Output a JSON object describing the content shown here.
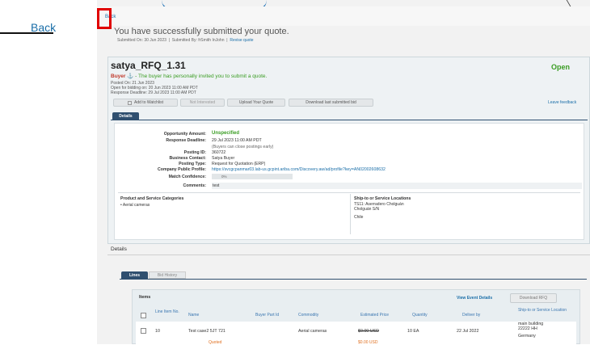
{
  "sidebar": {
    "back_label": "Back"
  },
  "header": {
    "back_link": "Back",
    "submitted_title": "You have successfully submitted your quote.",
    "submitted_on": "Submitted On: 30 Jun 2023",
    "submitted_by": "Submitted By: frSmith InJohn",
    "revise_quote": "Revise quote"
  },
  "rfq": {
    "title": "satya_RFQ_1.31",
    "status": "Open",
    "buyer_word": "Buyer",
    "buyer_message": " - The buyer has personally invited you to submit a quote.",
    "posted_on": "Posted On:  21 Jun 2023",
    "open_for_bidding": "Open for bidding on:  20 Jun 2023 11:00 AM PDT",
    "response_deadline": "Response Deadline:  29 Jul 2023 11:00 AM PDT"
  },
  "toolbar": {
    "add_watchlist": "Add to Watchlist",
    "not_interested": "Not Interested",
    "upload_quote": "Upload Your Quote",
    "download_bid": "Download last submitted bid",
    "leave_feedback": "Leave feedback"
  },
  "tabs": {
    "details": "Details"
  },
  "details": {
    "opportunity_amount_label": "Opportunity Amount:",
    "opportunity_amount": "Unspecified",
    "response_deadline_label": "Response Deadline:",
    "response_deadline": "29 Jul 2023 11:00 AM PDT",
    "response_deadline_note": "(Buyers can close postings early)",
    "posting_id_label": "Posting ID:",
    "posting_id": "360722",
    "business_contact_label": "Business Contact:",
    "business_contact": "Satya Buyer",
    "posting_type_label": "Posting Type:",
    "posting_type": "Request for Quotation  (ERP)",
    "public_profile_label": "Company Public Profile:",
    "public_profile": "https://svcgcpanmar03.lab-us.gcpint.ariba.com/Discovery.aw/ad/profile?key=AN02002608632",
    "match_confidence_label": "Match Confidence:",
    "match_confidence": "0%",
    "comments_label": "Comments:",
    "comments": "test",
    "categories_heading": "Product and Service Categories",
    "categories": [
      "Aerial cameras"
    ],
    "ship_heading": "Ship-to or Service Locations",
    "ship_lines": [
      "TS11: Aserradero Cholguán",
      "Cholguán S/N",
      "",
      "Chile"
    ]
  },
  "details_section": {
    "label": "Details"
  },
  "lines_tabs": {
    "lines": "Lines",
    "bid_history": "Bid History"
  },
  "items": {
    "title": "Items",
    "view_event_details": "View Event Details",
    "download_rfq": "Download RFQ",
    "headers": [
      "Line Item No.",
      "Name",
      "Buyer Part Id",
      "Commodity",
      "Estimated Price",
      "Quantity",
      "Deliver by",
      "Ship-to or Service Location"
    ],
    "row": {
      "line_no": "10",
      "name": "Test case2 5JT 721",
      "commodity": "Aerial cameras",
      "price": "$0.00 USD",
      "quantity": "10 EA",
      "deliver_by": "22 Jul 2022",
      "ship_to": [
        "main building",
        "22222 HH",
        "",
        "Germany"
      ]
    },
    "partial_label": "Quoted",
    "partial_price": "$0.00 USD"
  }
}
